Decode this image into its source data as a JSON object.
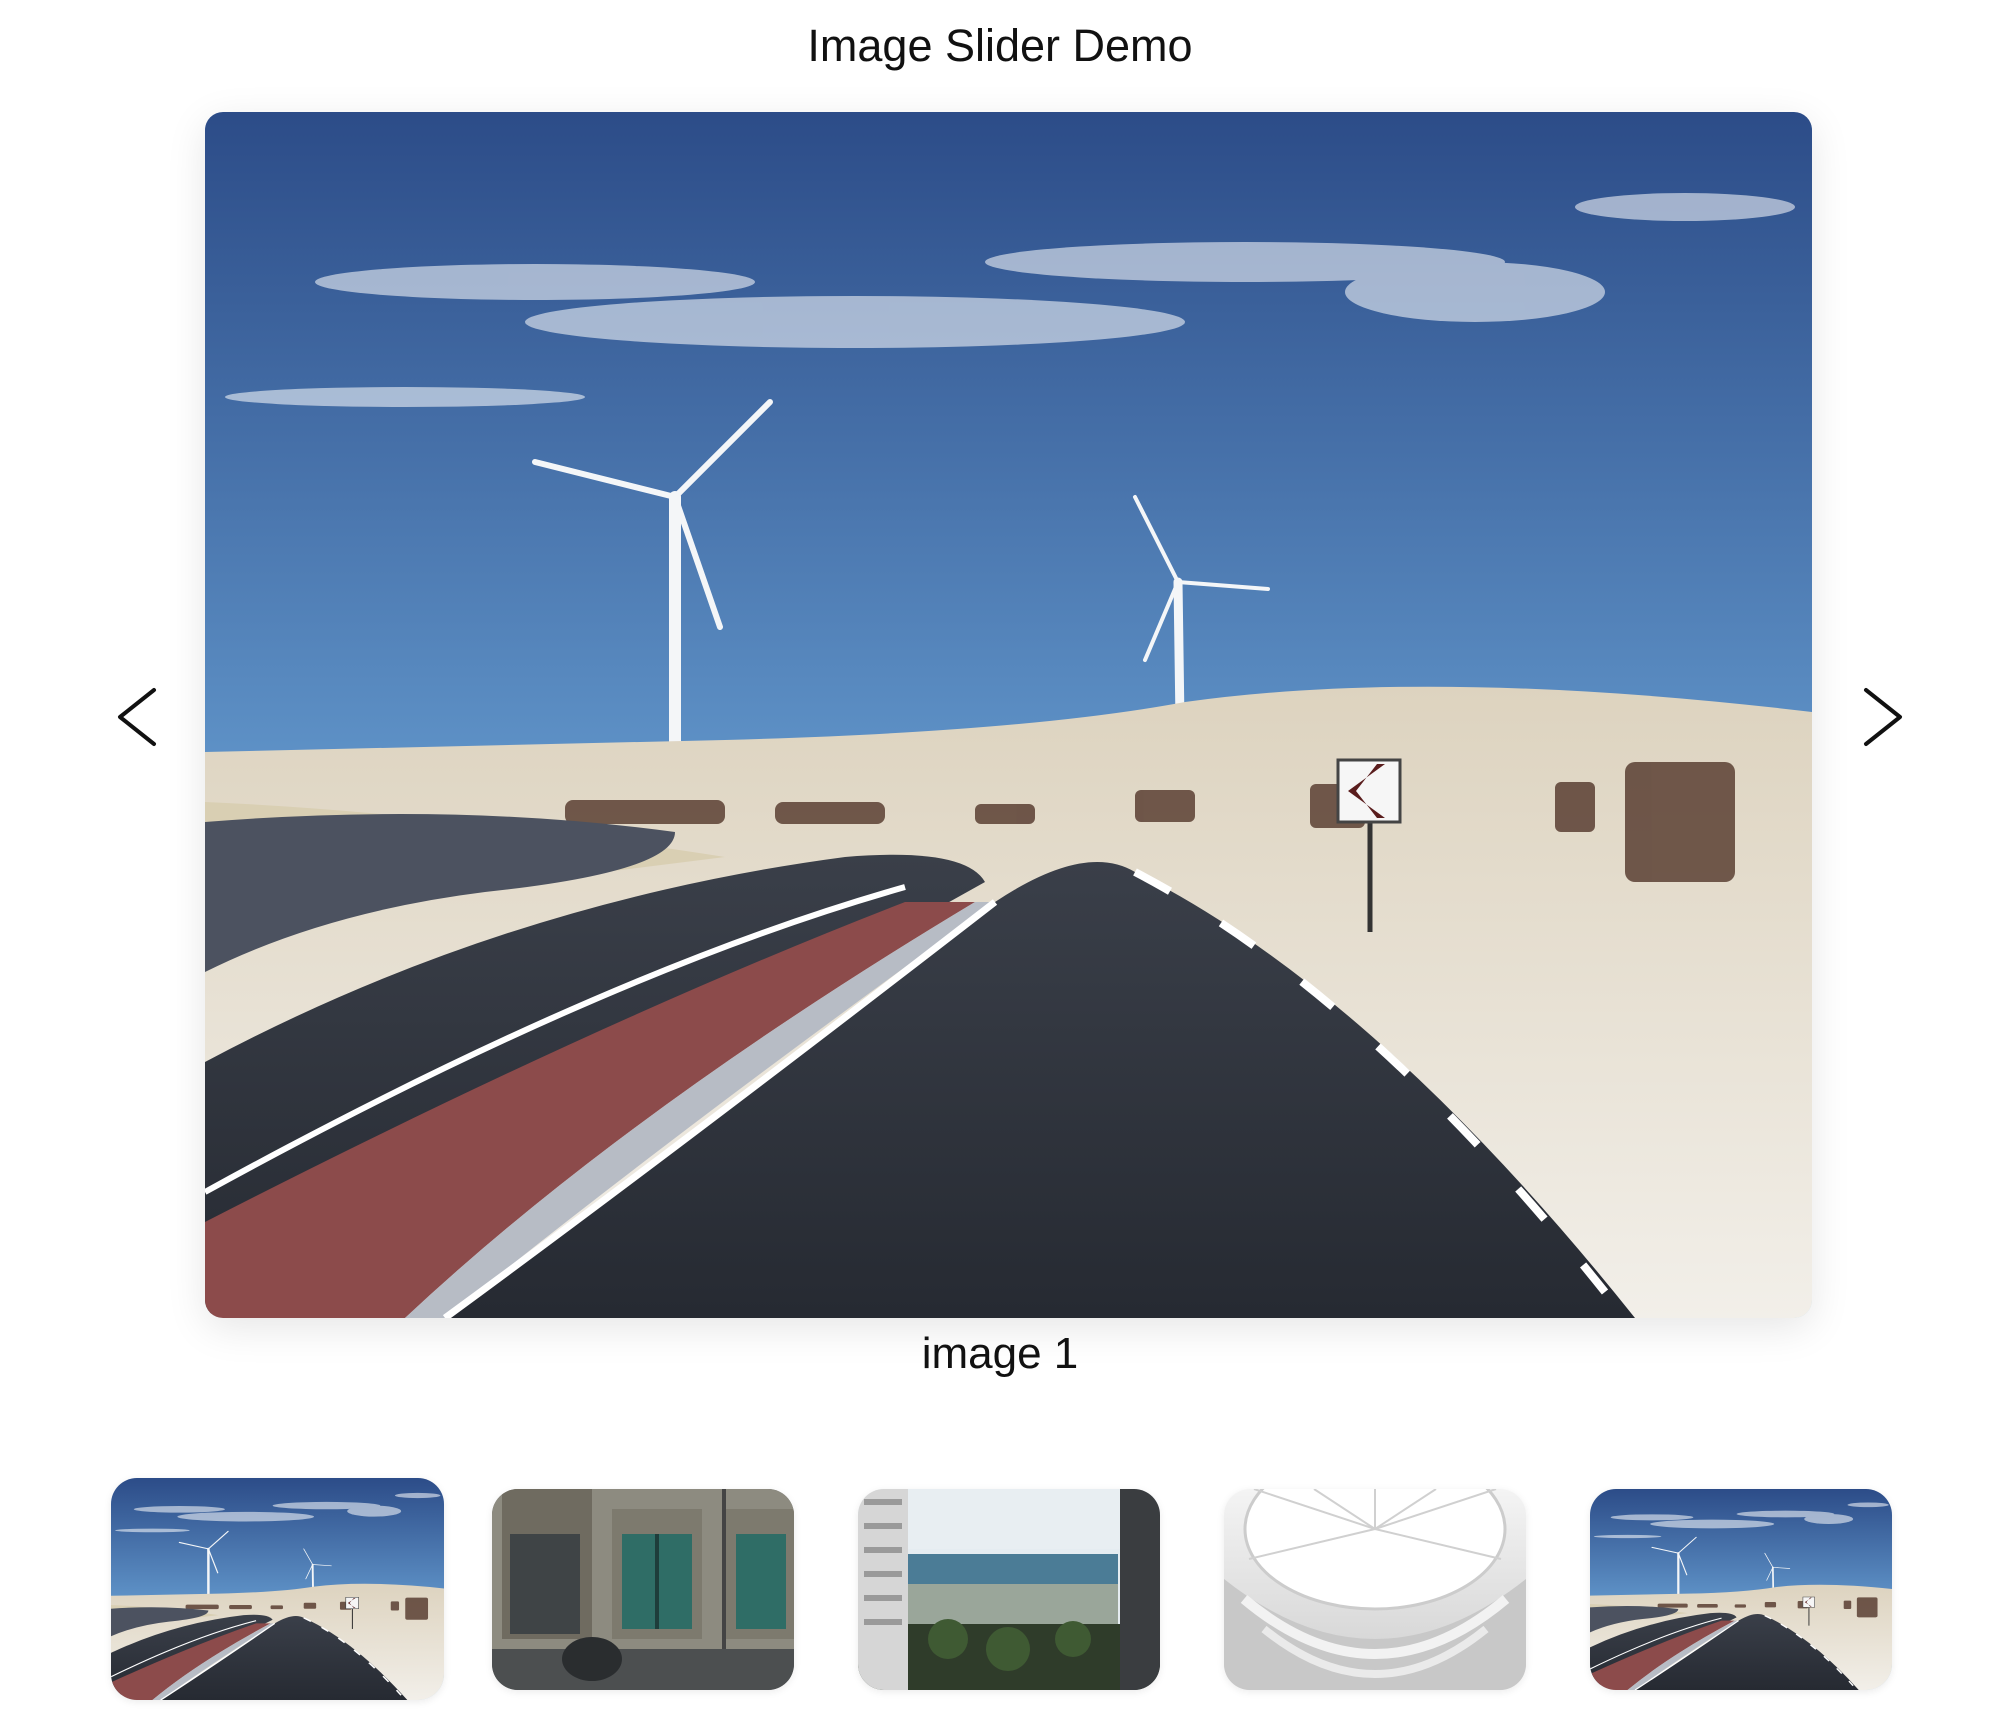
{
  "page": {
    "title": "Image Slider Demo"
  },
  "slider": {
    "caption": "image 1",
    "prev_icon": "chevron-left-icon",
    "next_icon": "chevron-right-icon",
    "active_index": 1,
    "slides_count": 5
  },
  "thumbnails": [
    {
      "name": "thumbnail-1",
      "subject": "wind-turbines-road",
      "active": true
    },
    {
      "name": "thumbnail-2",
      "subject": "old-building-cyclist",
      "active": false
    },
    {
      "name": "thumbnail-3",
      "subject": "sea-view-between-buildings",
      "active": false
    },
    {
      "name": "thumbnail-4",
      "subject": "white-dome-interior",
      "active": false
    },
    {
      "name": "thumbnail-5",
      "subject": "wind-turbines-road",
      "active": false
    }
  ],
  "colors": {
    "sky_top": "#2f4f8a",
    "sky_bottom": "#a9cde6",
    "sand": "#e9e2d4",
    "asphalt": "#2b2f38",
    "bike_lane": "#9b4a4a"
  }
}
